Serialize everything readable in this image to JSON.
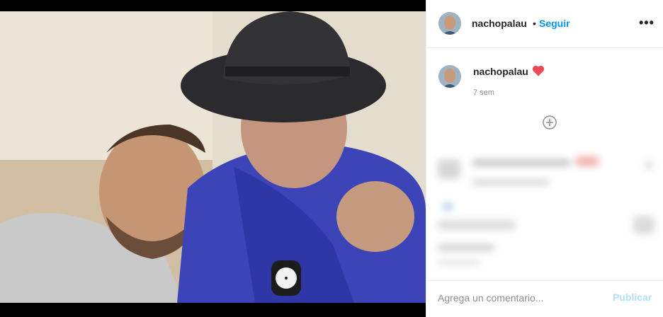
{
  "post": {
    "username": "nachopalau",
    "follow_label": "Seguir",
    "separator": "•",
    "more_icon": "more-horizontal-icon",
    "caption_username": "nachopalau",
    "caption_emoji": "heart-icon",
    "time_ago": "7 sem",
    "comment_placeholder": "Agrega un comentario...",
    "publish_label": "Publicar"
  },
  "colors": {
    "accent": "#0095f6",
    "publish_disabled": "#b2dffc",
    "heart": "#ed4956",
    "muted_text": "#8e8e8e"
  }
}
